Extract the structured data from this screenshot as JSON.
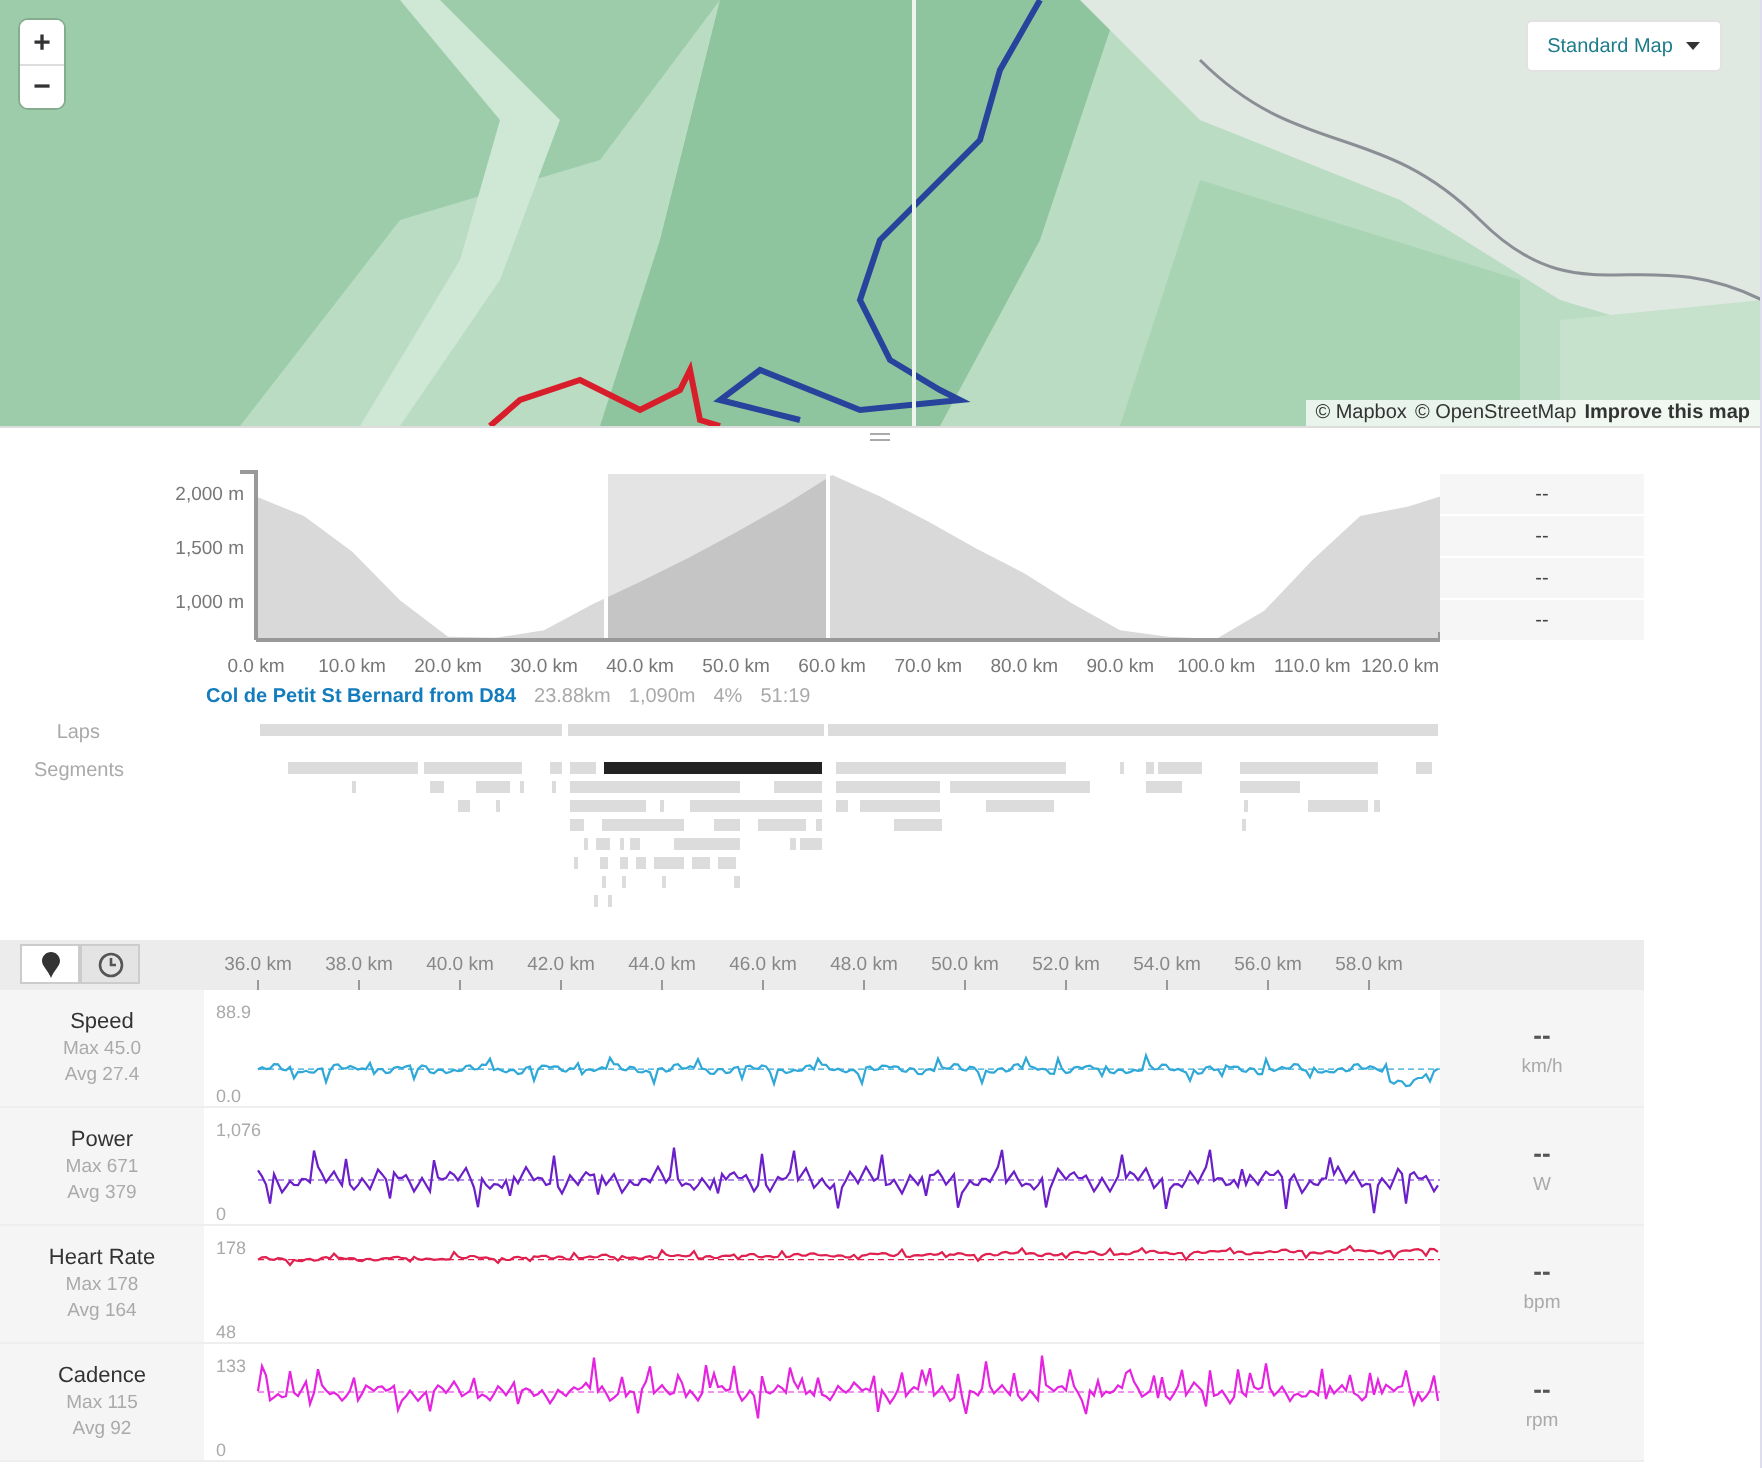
{
  "map": {
    "zoom_in": "+",
    "zoom_out": "−",
    "style_button": "Standard Map",
    "attribution": [
      "© Mapbox",
      "© OpenStreetMap",
      "Improve this map"
    ]
  },
  "elevation": {
    "chart_data": {
      "type": "area",
      "x": [
        0,
        5,
        10,
        15,
        20,
        25,
        30,
        35,
        40,
        45,
        50,
        55,
        60,
        65,
        70,
        75,
        80,
        85,
        90,
        95,
        100,
        105,
        110,
        115,
        120,
        123.3
      ],
      "values": [
        1960,
        1780,
        1450,
        1000,
        660,
        650,
        720,
        960,
        1170,
        1390,
        1630,
        1880,
        2160,
        1960,
        1730,
        1480,
        1250,
        970,
        720,
        660,
        640,
        900,
        1370,
        1780,
        1870,
        1960
      ],
      "xlim": [
        0,
        123.3
      ],
      "ylim": [
        630,
        2170
      ],
      "xticks": [
        {
          "value": 0,
          "label": "0.0 km"
        },
        {
          "value": 10,
          "label": "10.0 km"
        },
        {
          "value": 20,
          "label": "20.0 km"
        },
        {
          "value": 30,
          "label": "30.0 km"
        },
        {
          "value": 40,
          "label": "40.0 km"
        },
        {
          "value": 50,
          "label": "50.0 km"
        },
        {
          "value": 60,
          "label": "60.0 km"
        },
        {
          "value": 70,
          "label": "70.0 km"
        },
        {
          "value": 80,
          "label": "80.0 km"
        },
        {
          "value": 90,
          "label": "90.0 km"
        },
        {
          "value": 100,
          "label": "100.0 km"
        },
        {
          "value": 110,
          "label": "110.0 km"
        },
        {
          "value": 120,
          "label": "120.0 km"
        }
      ],
      "yticks": [
        {
          "value": 1000,
          "label": "1,000 m"
        },
        {
          "value": 1500,
          "label": "1,500 m"
        },
        {
          "value": 2000,
          "label": "2,000 m"
        }
      ]
    },
    "stats": [
      "--",
      "--",
      "--",
      "--"
    ]
  },
  "segment_summary": {
    "name": "Col de Petit St Bernard from D84",
    "distance": "23.88km",
    "elevation_gain": "1,090m",
    "grade": "4%",
    "time": "51:19"
  },
  "tracks": {
    "laps_label": "Laps",
    "segments_label": "Segments"
  },
  "streams": {
    "axis_modes": [
      {
        "kind": "distance",
        "selected": true
      },
      {
        "kind": "time",
        "selected": false
      }
    ],
    "xticks": [
      "36.0 km",
      "38.0 km",
      "40.0 km",
      "42.0 km",
      "44.0 km",
      "46.0 km",
      "48.0 km",
      "50.0 km",
      "52.0 km",
      "54.0 km",
      "56.0 km",
      "58.0 km"
    ],
    "rows": [
      {
        "name": "Speed",
        "max": "Max 45.0",
        "avg": "Avg 27.4",
        "y_max": "88.9",
        "y_min": "0.0",
        "color": "#2fa8d8",
        "value": "--",
        "unit": "km/h"
      },
      {
        "name": "Power",
        "max": "Max 671",
        "avg": "Avg 379",
        "y_max": "1,076",
        "y_min": "0",
        "color": "#6a1fc8",
        "value": "--",
        "unit": "W"
      },
      {
        "name": "Heart Rate",
        "max": "Max 178",
        "avg": "Avg 164",
        "y_max": "178",
        "y_min": "48",
        "color": "#e0204f",
        "value": "--",
        "unit": "bpm"
      },
      {
        "name": "Cadence",
        "max": "Max 115",
        "avg": "Avg 92",
        "y_max": "133",
        "y_min": "0",
        "color": "#e524e0",
        "value": "--",
        "unit": "rpm"
      }
    ]
  }
}
